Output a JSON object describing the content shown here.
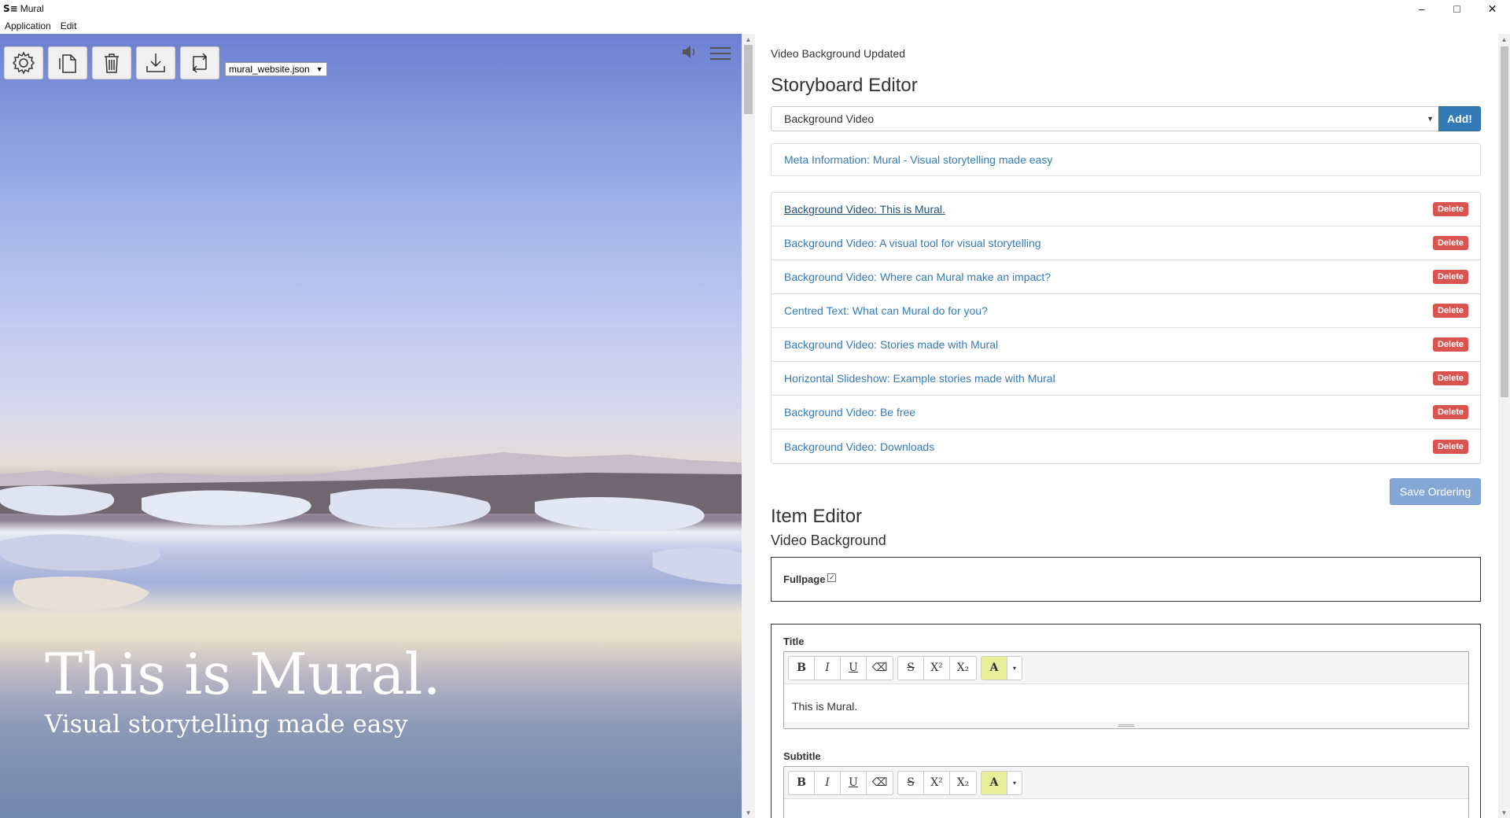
{
  "window": {
    "logo": "S≡",
    "title": "Mural",
    "controls": [
      "–",
      "□",
      "✕"
    ]
  },
  "menu": [
    "Application",
    "Edit"
  ],
  "preview": {
    "file_select": "mural_website.json",
    "hero_title": "This is Mural.",
    "hero_subtitle": "Visual storytelling made easy",
    "tools": [
      "settings-icon",
      "copy-icon",
      "trash-icon",
      "download-icon",
      "sync-icon"
    ]
  },
  "editor": {
    "status": "Video Background Updated",
    "storyboard_heading": "Storyboard Editor",
    "type_select": "Background Video",
    "add_label": "Add!",
    "meta_item": "Meta Information: Mural - Visual storytelling made easy",
    "items": [
      {
        "label": "Background Video: This is Mural.",
        "delete": "Delete"
      },
      {
        "label": "Background Video: A visual tool for visual storytelling",
        "delete": "Delete"
      },
      {
        "label": "Background Video: Where can Mural make an impact?",
        "delete": "Delete"
      },
      {
        "label": "Centred Text: What can Mural do for you?",
        "delete": "Delete"
      },
      {
        "label": "Background Video: Stories made with Mural",
        "delete": "Delete"
      },
      {
        "label": "Horizontal Slideshow: Example stories made with Mural",
        "delete": "Delete"
      },
      {
        "label": "Background Video: Be free",
        "delete": "Delete"
      },
      {
        "label": "Background Video: Downloads",
        "delete": "Delete"
      }
    ],
    "save_label": "Save Ordering",
    "item_heading": "Item Editor",
    "item_type": "Video Background",
    "fullpage_label": "Fullpage",
    "fullpage_checked": true,
    "title_label": "Title",
    "title_value": "This is Mural.",
    "subtitle_label": "Subtitle",
    "subtitle_value": "",
    "rte_buttons": [
      "B",
      "I",
      "U",
      "⌫",
      "S",
      "X²",
      "X₂",
      "A",
      "▾"
    ],
    "accent_color": "#337ab7",
    "delete_color": "#d9534f"
  }
}
